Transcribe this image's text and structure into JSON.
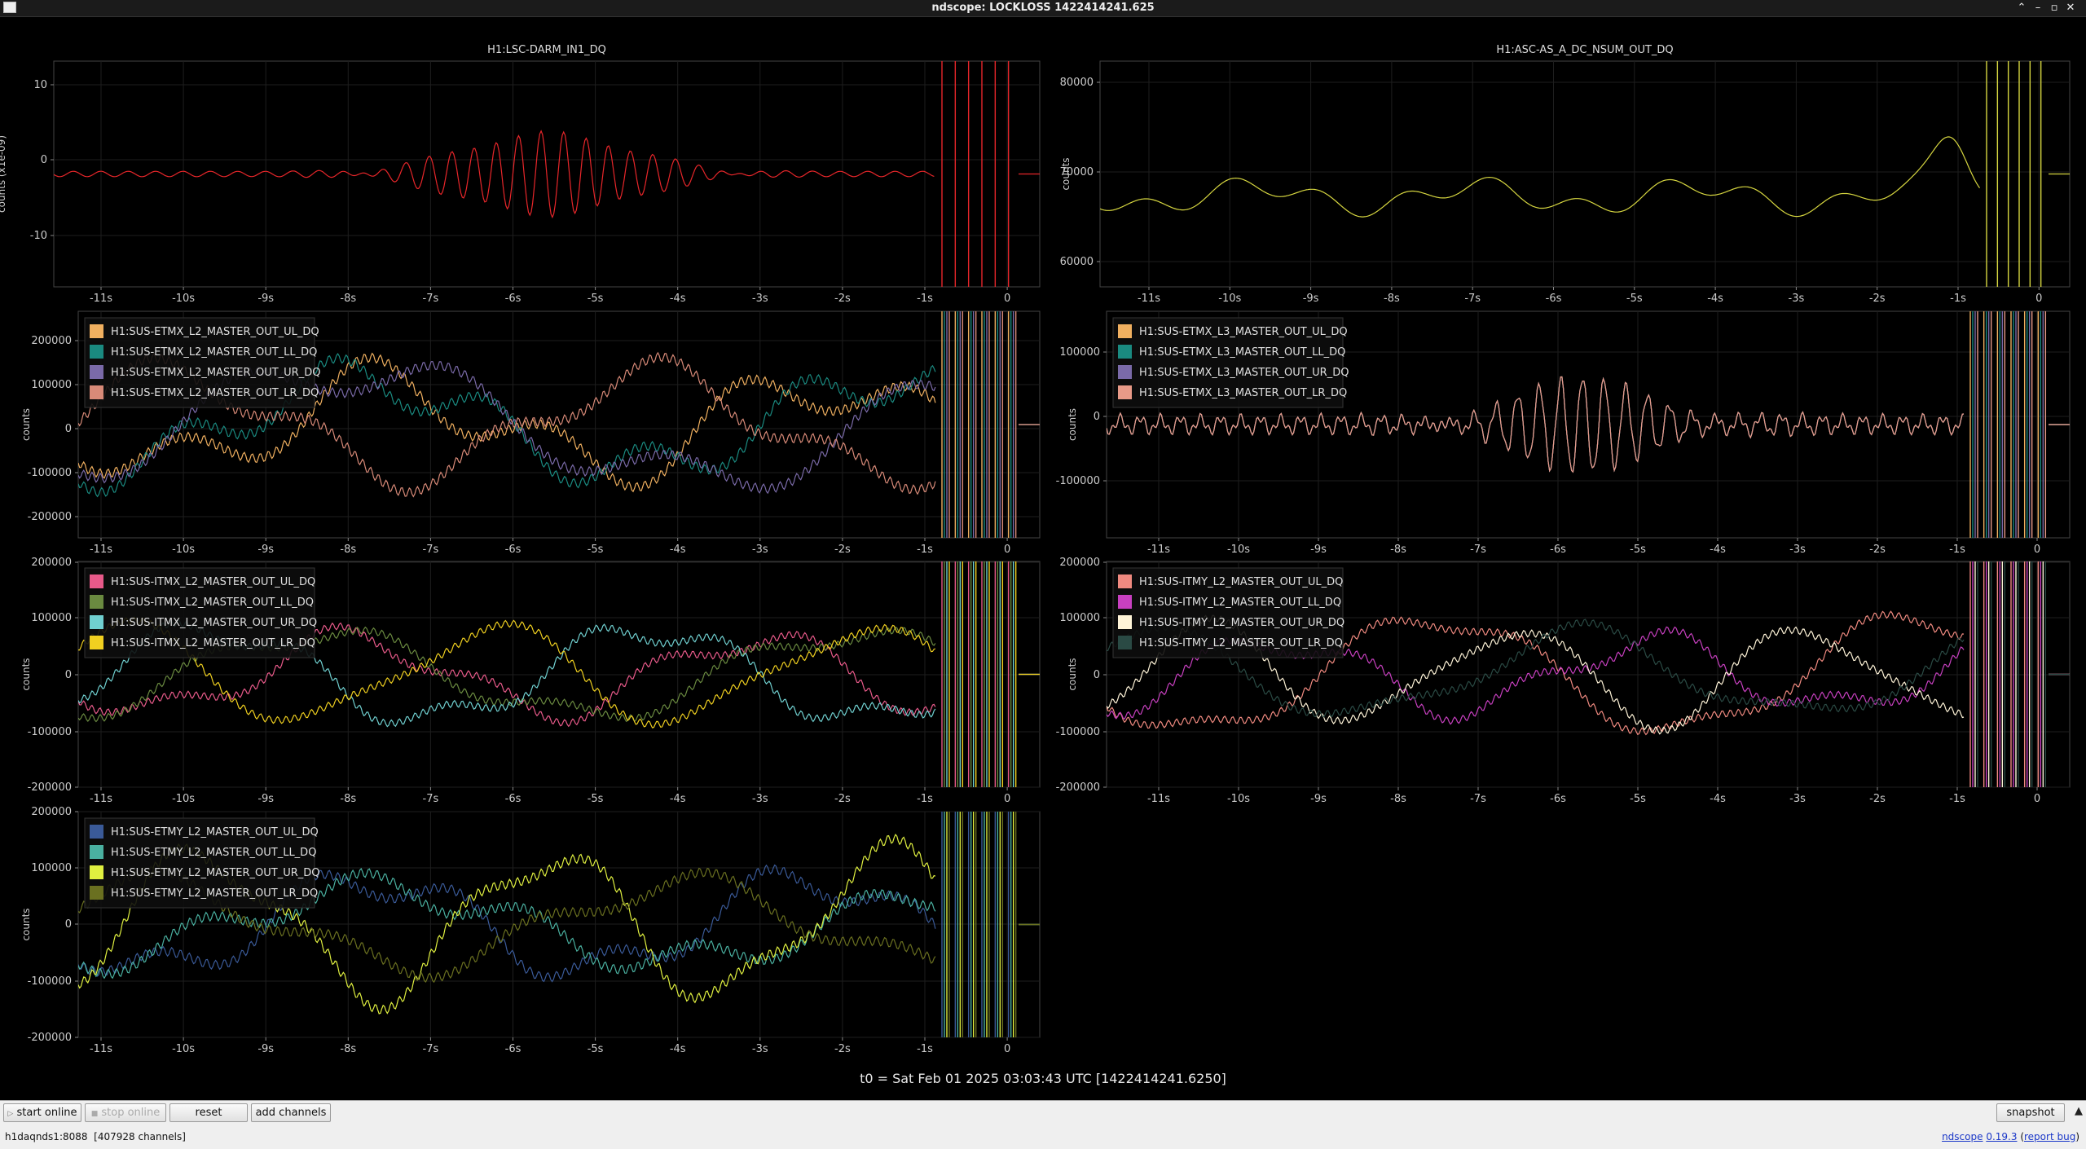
{
  "window": {
    "title": "ndscope: LOCKLOSS 1422414241.625"
  },
  "plots": [
    {
      "id": "p1",
      "title": "H1:LSC-DARM_IN1_DQ",
      "ylabel": "counts (x1e-09)",
      "yticks": [
        "10",
        "0",
        "-10"
      ],
      "xticks": [
        "-11s",
        "-10s",
        "-9s",
        "-8s",
        "-7s",
        "-6s",
        "-5s",
        "-4s",
        "-3s",
        "-2s",
        "-1s",
        "0"
      ],
      "legend": [],
      "series": [
        {
          "color": "#e8262a"
        }
      ]
    },
    {
      "id": "p2",
      "title": "H1:ASC-AS_A_DC_NSUM_OUT_DQ",
      "ylabel": "counts",
      "yticks": [
        "80000",
        "70000",
        "60000"
      ],
      "xticks": [
        "-11s",
        "-10s",
        "-9s",
        "-8s",
        "-7s",
        "-6s",
        "-5s",
        "-4s",
        "-3s",
        "-2s",
        "-1s",
        "0"
      ],
      "legend": [],
      "series": [
        {
          "color": "#d6d640"
        }
      ]
    },
    {
      "id": "p3",
      "title": "",
      "ylabel": "counts",
      "yticks": [
        "200000",
        "100000",
        "0",
        "-100000",
        "-200000"
      ],
      "xticks": [
        "-11s",
        "-10s",
        "-9s",
        "-8s",
        "-7s",
        "-6s",
        "-5s",
        "-4s",
        "-3s",
        "-2s",
        "-1s",
        "0"
      ],
      "legend": [
        "H1:SUS-ETMX_L2_MASTER_OUT_UL_DQ",
        "H1:SUS-ETMX_L2_MASTER_OUT_LL_DQ",
        "H1:SUS-ETMX_L2_MASTER_OUT_UR_DQ",
        "H1:SUS-ETMX_L2_MASTER_OUT_LR_DQ"
      ],
      "series": [
        {
          "color": "#f0b060"
        },
        {
          "color": "#1a8a80"
        },
        {
          "color": "#7a6aa8"
        },
        {
          "color": "#d88a78"
        }
      ]
    },
    {
      "id": "p4",
      "title": "",
      "ylabel": "counts",
      "yticks": [
        "100000",
        "0",
        "-100000"
      ],
      "xticks": [
        "-11s",
        "-10s",
        "-9s",
        "-8s",
        "-7s",
        "-6s",
        "-5s",
        "-4s",
        "-3s",
        "-2s",
        "-1s",
        "0"
      ],
      "legend": [
        "H1:SUS-ETMX_L3_MASTER_OUT_UL_DQ",
        "H1:SUS-ETMX_L3_MASTER_OUT_LL_DQ",
        "H1:SUS-ETMX_L3_MASTER_OUT_UR_DQ",
        "H1:SUS-ETMX_L3_MASTER_OUT_LR_DQ"
      ],
      "series": [
        {
          "color": "#f0b060"
        },
        {
          "color": "#1a8a80"
        },
        {
          "color": "#7a6aa8"
        },
        {
          "color": "#e89a88"
        }
      ]
    },
    {
      "id": "p5",
      "title": "",
      "ylabel": "counts",
      "yticks": [
        "200000",
        "100000",
        "0",
        "-100000",
        "-200000"
      ],
      "xticks": [
        "-11s",
        "-10s",
        "-9s",
        "-8s",
        "-7s",
        "-6s",
        "-5s",
        "-4s",
        "-3s",
        "-2s",
        "-1s",
        "0"
      ],
      "legend": [
        "H1:SUS-ITMX_L2_MASTER_OUT_UL_DQ",
        "H1:SUS-ITMX_L2_MASTER_OUT_LL_DQ",
        "H1:SUS-ITMX_L2_MASTER_OUT_UR_DQ",
        "H1:SUS-ITMX_L2_MASTER_OUT_LR_DQ"
      ],
      "series": [
        {
          "color": "#e85a8a"
        },
        {
          "color": "#6a8a40"
        },
        {
          "color": "#70d0d0"
        },
        {
          "color": "#f0d020"
        }
      ]
    },
    {
      "id": "p6",
      "title": "",
      "ylabel": "counts",
      "yticks": [
        "200000",
        "100000",
        "0",
        "-100000",
        "-200000"
      ],
      "xticks": [
        "-11s",
        "-10s",
        "-9s",
        "-8s",
        "-7s",
        "-6s",
        "-5s",
        "-4s",
        "-3s",
        "-2s",
        "-1s",
        "0"
      ],
      "legend": [
        "H1:SUS-ITMY_L2_MASTER_OUT_UL_DQ",
        "H1:SUS-ITMY_L2_MASTER_OUT_LL_DQ",
        "H1:SUS-ITMY_L2_MASTER_OUT_UR_DQ",
        "H1:SUS-ITMY_L2_MASTER_OUT_LR_DQ"
      ],
      "series": [
        {
          "color": "#f08a80"
        },
        {
          "color": "#c840c0"
        },
        {
          "color": "#fff4d8"
        },
        {
          "color": "#2a4a44"
        }
      ]
    },
    {
      "id": "p7",
      "title": "",
      "ylabel": "counts",
      "yticks": [
        "200000",
        "100000",
        "0",
        "-100000",
        "-200000"
      ],
      "xticks": [
        "-11s",
        "-10s",
        "-9s",
        "-8s",
        "-7s",
        "-6s",
        "-5s",
        "-4s",
        "-3s",
        "-2s",
        "-1s",
        "0"
      ],
      "legend": [
        "H1:SUS-ETMY_L2_MASTER_OUT_UL_DQ",
        "H1:SUS-ETMY_L2_MASTER_OUT_LL_DQ",
        "H1:SUS-ETMY_L2_MASTER_OUT_UR_DQ",
        "H1:SUS-ETMY_L2_MASTER_OUT_LR_DQ"
      ],
      "series": [
        {
          "color": "#3a5a98"
        },
        {
          "color": "#4ab0a0"
        },
        {
          "color": "#e0f040"
        },
        {
          "color": "#6a7020"
        }
      ]
    }
  ],
  "t0_label": "t0 = Sat Feb 01 2025 03:03:43 UTC [1422414241.6250]",
  "buttons": {
    "start_online": "start online",
    "stop_online": "stop online",
    "reset": "reset",
    "add_channels": "add channels",
    "snapshot": "snapshot"
  },
  "status": {
    "server": "h1daqnds1:8088",
    "channels": "[407928 channels]",
    "app": "ndscope",
    "version": "0.19.3",
    "report": "report bug"
  }
}
